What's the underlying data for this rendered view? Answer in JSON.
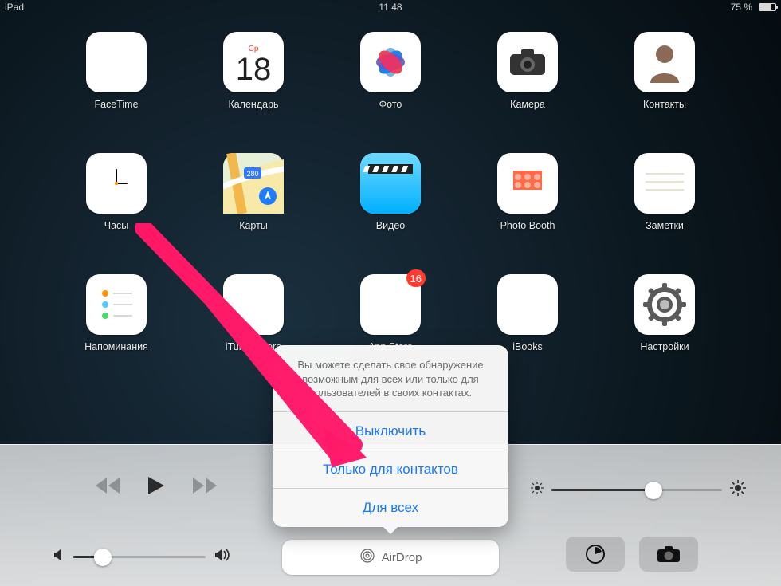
{
  "status": {
    "left": "iPad",
    "time": "11:48",
    "battery_pct": "75 %"
  },
  "apps": {
    "facetime": {
      "label": "FaceTime"
    },
    "calendar": {
      "label": "Календарь",
      "weekday": "Ср",
      "day": "18"
    },
    "photos": {
      "label": "Фото"
    },
    "camera": {
      "label": "Камера"
    },
    "contacts": {
      "label": "Контакты"
    },
    "clock": {
      "label": "Часы"
    },
    "maps": {
      "label": "Карты"
    },
    "videos": {
      "label": "Видео"
    },
    "photobooth": {
      "label": "Photo Booth"
    },
    "notes": {
      "label": "Заметки"
    },
    "reminders": {
      "label": "Напоминания"
    },
    "itunes": {
      "label": "iTunes Store"
    },
    "appstore": {
      "label": "App Store",
      "badge": "16"
    },
    "ibooks": {
      "label": "iBooks"
    },
    "settings": {
      "label": "Настройки"
    }
  },
  "cc": {
    "airdrop_label": "AirDrop",
    "volume_pct": 22,
    "brightness_pct": 60
  },
  "popover": {
    "text": "Вы можете сделать свое обнаружение возможным для всех или только для пользователей в своих контактах.",
    "opt_off": "Выключить",
    "opt_contacts": "Только для контактов",
    "opt_all": "Для всех"
  }
}
